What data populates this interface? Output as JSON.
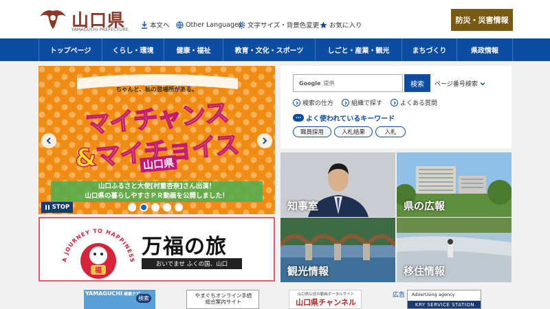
{
  "header": {
    "logo_name": "山口県",
    "logo_sub": "YAMAGUCHI PREFECTURE",
    "utility": {
      "skip": "本文へ",
      "languages": "Other Languages",
      "font_size": "文字サイズ・背景色変更",
      "favorites": "お気に入り"
    },
    "disaster_button": "防災・災害情報"
  },
  "nav": {
    "items": [
      "トップページ",
      "くらし・環境",
      "健康・福祉",
      "教育・文化・スポーツ",
      "しごと・産業・観光",
      "まちづくり",
      "県政情報"
    ]
  },
  "hero": {
    "tag": "ちゃんと、私の居場所がある。",
    "title_line1": "マイチャンス",
    "title_line2": "&マイチョイス",
    "pref": "山口県",
    "caption_line1": "山口ふるさと大使[村重杏奈]さん出演！",
    "caption_line2": "山口県の暮らしやすさＰＲ動画を公開しました！",
    "stop_label": "STOP",
    "slide_count": 5,
    "active_slide": 2
  },
  "banner": {
    "arc_text": "A JOURNEY TO HAPPINESS",
    "daruma_char": "福",
    "title": "万福の旅",
    "subtitle": "おいでませ ふくの国、山口"
  },
  "search": {
    "provider": "Google",
    "provider_suffix": "提供",
    "button": "検索",
    "page_number_search": "ページ番号検索",
    "links": [
      "検索の仕方",
      "組織で探す",
      "よくある質問"
    ],
    "keywords_title": "よく使われているキーワード",
    "keywords": [
      "職員採用",
      "入札結果",
      "入札"
    ]
  },
  "tiles": [
    "知事室",
    "県の広報",
    "観光情報",
    "移住情報"
  ],
  "bottom": {
    "b1_title": "YAMAGUCHI",
    "b1_title_suffix": "検索ナビ",
    "b1_btn": "検索",
    "b2_line1": "やまぐちオンライン手続",
    "b2_line2": "総合案内サイト",
    "b3_sub": "山口県公式の動画ポータルサイト",
    "b3_title": "山口県チャンネル",
    "ad_label": "広告",
    "b4_sub": "Advertising agency",
    "b4_title": "KRY SERVICE STATION"
  },
  "colors": {
    "nav_blue": "#0c4da2",
    "disaster_brown": "#7a5a12",
    "logo_red": "#8b3a2a",
    "hero_orange": "#f08c14"
  }
}
